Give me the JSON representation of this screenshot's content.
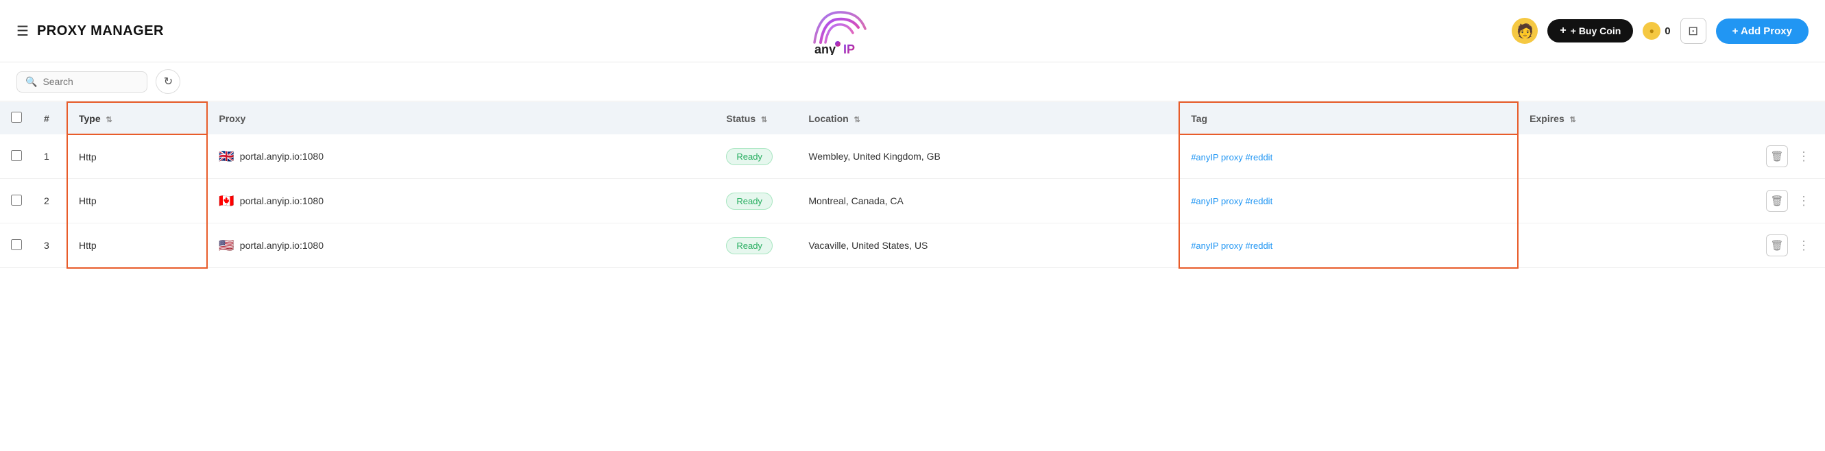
{
  "header": {
    "hamburger_label": "☰",
    "title": "PROXY MANAGER",
    "buy_coin_label": "+ Buy Coin",
    "coin_balance": "0",
    "coin_symbol": "●",
    "monitor_symbol": "⊡",
    "add_proxy_label": "+ Add Proxy",
    "avatar_symbol": "🧑"
  },
  "toolbar": {
    "search_placeholder": "Search",
    "refresh_symbol": "↻"
  },
  "table": {
    "columns": [
      {
        "id": "check",
        "label": ""
      },
      {
        "id": "num",
        "label": "#"
      },
      {
        "id": "type",
        "label": "Type"
      },
      {
        "id": "proxy",
        "label": "Proxy"
      },
      {
        "id": "status",
        "label": "Status"
      },
      {
        "id": "location",
        "label": "Location"
      },
      {
        "id": "tag",
        "label": "Tag"
      },
      {
        "id": "expires",
        "label": "Expires"
      },
      {
        "id": "actions",
        "label": ""
      }
    ],
    "rows": [
      {
        "num": "1",
        "type": "Http",
        "flag": "🇬🇧",
        "proxy": "portal.anyip.io:1080",
        "status": "Ready",
        "location": "Wembley, United Kingdom, GB",
        "tag": "#anyIP proxy #reddit",
        "expires": ""
      },
      {
        "num": "2",
        "type": "Http",
        "flag": "🇨🇦",
        "proxy": "portal.anyip.io:1080",
        "status": "Ready",
        "location": "Montreal, Canada, CA",
        "tag": "#anyIP proxy #reddit",
        "expires": ""
      },
      {
        "num": "3",
        "type": "Http",
        "flag": "🇺🇸",
        "proxy": "portal.anyip.io:1080",
        "status": "Ready",
        "location": "Vacaville, United States, US",
        "tag": "#anyIP proxy #reddit",
        "expires": ""
      }
    ]
  },
  "logo": {
    "text": "anyIP",
    "tagline": ""
  },
  "colors": {
    "accent": "#e85c2a",
    "blue": "#2196f3",
    "dark": "#111111",
    "ready_bg": "#e6f7ee",
    "ready_text": "#27ae60"
  }
}
